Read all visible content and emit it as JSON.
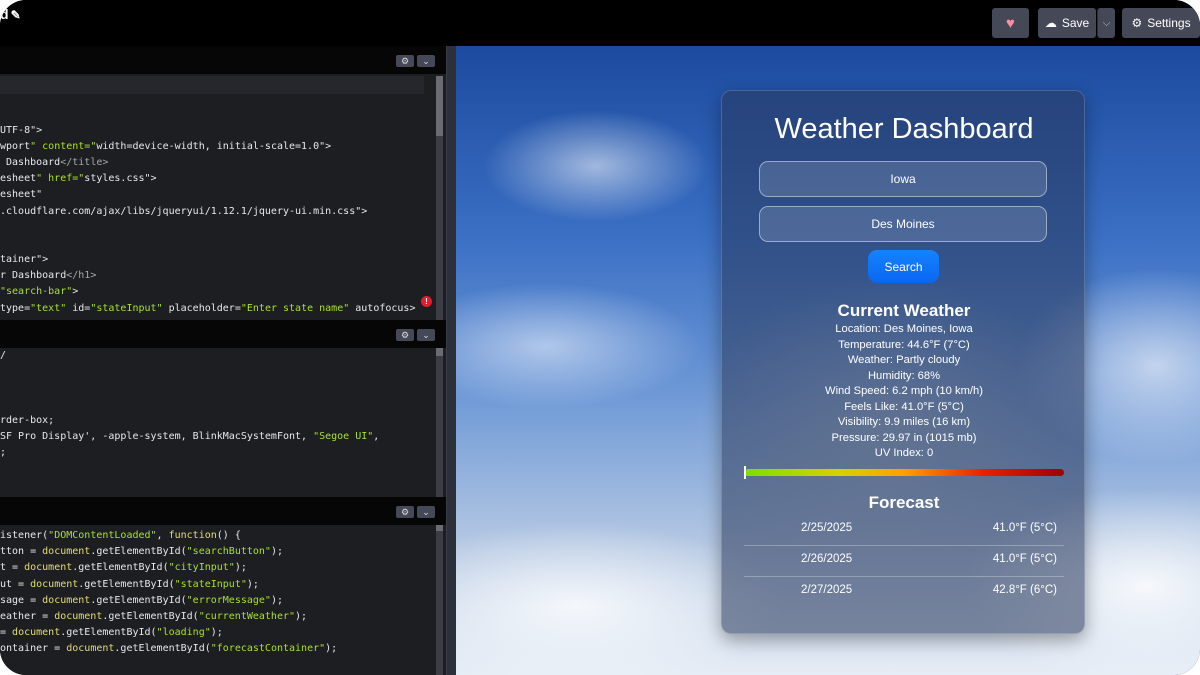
{
  "topbar": {
    "project_title": "d",
    "heart_icon": "♥",
    "save_label": "Save",
    "settings_label": "Settings"
  },
  "html_pane": {
    "lines": [
      "",
      "",
      "",
      "UTF-8\">",
      "wport\" content=\"width=device-width, initial-scale=1.0\">",
      " Dashboard</title>",
      "esheet\" href=\"styles.css\">",
      "esheet\"",
      ".cloudflare.com/ajax/libs/jqueryui/1.12.1/jquery-ui.min.css\">",
      "",
      "",
      "tainer\">",
      "r Dashboard</h1>",
      "\"search-bar\">",
      "type=\"text\" id=\"stateInput\" placeholder=\"Enter state name\" autofocus>"
    ]
  },
  "css_pane": {
    "lines": [
      "/",
      "",
      "",
      "",
      "rder-box;",
      "SF Pro Display', -apple-system, BlinkMacSystemFont, \"Segoe UI\",",
      ";"
    ]
  },
  "js_pane": {
    "lines": [
      "istener(\"DOMContentLoaded\", function() {",
      "tton = document.getElementById(\"searchButton\");",
      "t = document.getElementById(\"cityInput\");",
      "ut = document.getElementById(\"stateInput\");",
      "sage = document.getElementById(\"errorMessage\");",
      "eather = document.getElementById(\"currentWeather\");",
      "= document.getElementById(\"loading\");",
      "ontainer = document.getElementById(\"forecastContainer\");"
    ]
  },
  "dashboard": {
    "title": "Weather Dashboard",
    "state_value": "Iowa",
    "city_value": "Des Moines",
    "search_label": "Search",
    "current_title": "Current Weather",
    "current_lines": [
      "Location: Des Moines, Iowa",
      "Temperature: 44.6°F (7°C)",
      "Weather: Partly cloudy",
      "Humidity: 68%",
      "Wind Speed: 6.2 mph (10 km/h)",
      "Feels Like: 41.0°F (5°C)",
      "Visibility: 9.9 miles (16 km)",
      "Pressure: 29.97 in (1015 mb)",
      "UV Index: 0"
    ],
    "uv_index": 0,
    "forecast_title": "Forecast",
    "forecast": [
      {
        "date": "2/25/2025",
        "temp": "41.0°F (5°C)"
      },
      {
        "date": "2/26/2025",
        "temp": "41.0°F (5°C)"
      },
      {
        "date": "2/27/2025",
        "temp": "42.8°F (6°C)"
      }
    ]
  }
}
